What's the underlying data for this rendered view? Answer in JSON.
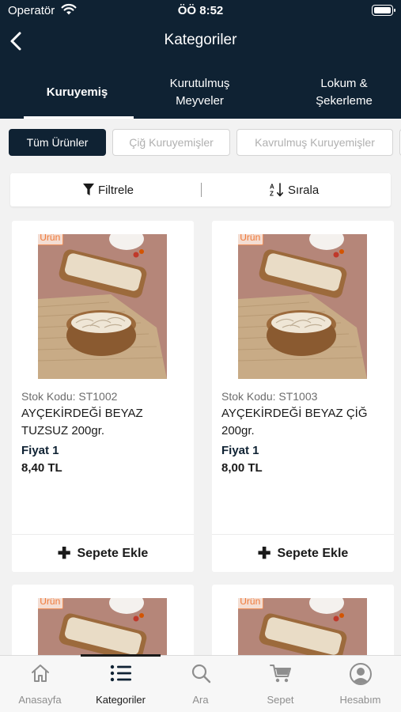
{
  "status": {
    "operator": "Operatör",
    "time": "ÖÖ 8:52"
  },
  "header": {
    "title": "Kategoriler"
  },
  "tabs": [
    {
      "label": "Kuruyemiş"
    },
    {
      "label": "Kurutulmuş Meyveler"
    },
    {
      "label": "Lokum & Şekerleme"
    }
  ],
  "chips": [
    {
      "label": "Tüm Ürünler"
    },
    {
      "label": "Çiğ Kuruyemişler"
    },
    {
      "label": "Kavrulmuş Kuruyemişler"
    }
  ],
  "toolbar": {
    "filter_label": "Filtrele",
    "sort_label": "Sırala"
  },
  "products": [
    {
      "badge": "Yeni Ürün",
      "sku": "Stok Kodu: ST1002",
      "name": "AYÇEKİRDEĞİ BEYAZ TUZSUZ 200gr.",
      "price_label": "Fiyat 1",
      "price": "8,40 TL",
      "cart_label": "Sepete Ekle"
    },
    {
      "badge": "Yeni Ürün",
      "sku": "Stok Kodu: ST1003",
      "name": "AYÇEKİRDEĞİ BEYAZ ÇİĞ 200gr.",
      "price_label": "Fiyat 1",
      "price": "8,00 TL",
      "cart_label": "Sepete Ekle"
    },
    {
      "badge": "Yeni Ürün"
    },
    {
      "badge": "Yeni Ürün"
    }
  ],
  "nav": [
    {
      "label": "Anasayfa",
      "icon": "home-icon"
    },
    {
      "label": "Kategoriler",
      "icon": "list-icon"
    },
    {
      "label": "Ara",
      "icon": "search-icon"
    },
    {
      "label": "Sepet",
      "icon": "cart-icon"
    },
    {
      "label": "Hesabım",
      "icon": "account-icon"
    }
  ],
  "colors": {
    "primary": "#0f2233",
    "badge": "#ef7a3a",
    "background": "#f2f2f2"
  }
}
